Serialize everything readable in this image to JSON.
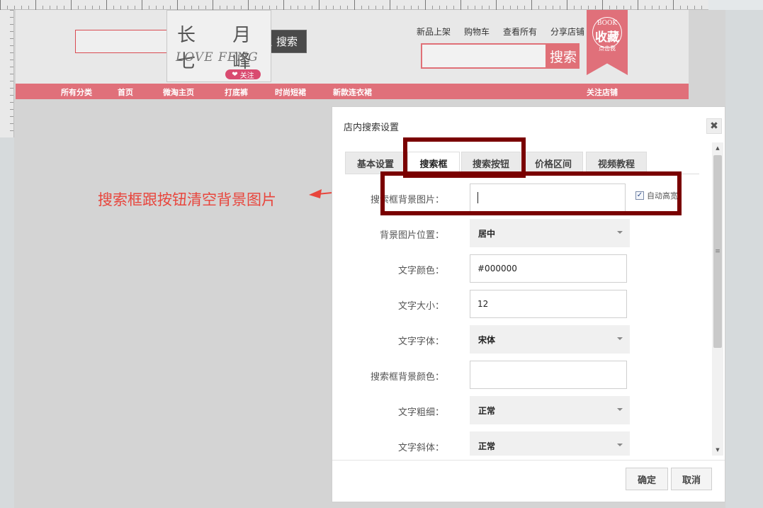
{
  "store": {
    "search_button_label": "搜索",
    "logo_line1": "长 月 七 峰",
    "logo_line2": "LOVE FENG",
    "follow_label": "关注",
    "top_links": [
      "新品上架",
      "购物车",
      "查看所有",
      "分享店铺"
    ],
    "top_search_button": "搜索",
    "fav_line1": "BOOK",
    "fav_line2": "收藏",
    "fav_line3": "点击我",
    "nav_items": [
      "所有分类",
      "首页",
      "微淘主页",
      "打底裤",
      "时尚短裙",
      "新款连衣裙",
      "关注店铺"
    ]
  },
  "annotation": {
    "text": "搜索框跟按钮清空背景图片"
  },
  "dialog": {
    "title": "店内搜索设置",
    "close_label": "✖",
    "tabs": [
      "基本设置",
      "搜索框",
      "搜索按钮",
      "价格区间",
      "视频教程"
    ],
    "active_tab": "搜索框",
    "fields": {
      "bg_image_label": "搜索框背景图片：",
      "bg_image_value": "",
      "auto_label": "自动高宽",
      "bg_position_label": "背景图片位置：",
      "bg_position_value": "居中",
      "text_color_label": "文字颜色：",
      "text_color_value": "#000000",
      "text_size_label": "文字大小：",
      "text_size_value": "12",
      "font_label": "文字字体：",
      "font_value": "宋体",
      "bg_color_label": "搜索框背景颜色：",
      "bg_color_value": "",
      "bold_label": "文字粗细：",
      "bold_value": "正常",
      "italic_label": "文字斜体：",
      "italic_value": "正常"
    },
    "confirm_label": "确定",
    "cancel_label": "取消"
  },
  "colors": {
    "brand_pink": "#e0707a",
    "highlight_border": "#7a0000",
    "annotation_red": "#e8453c"
  }
}
